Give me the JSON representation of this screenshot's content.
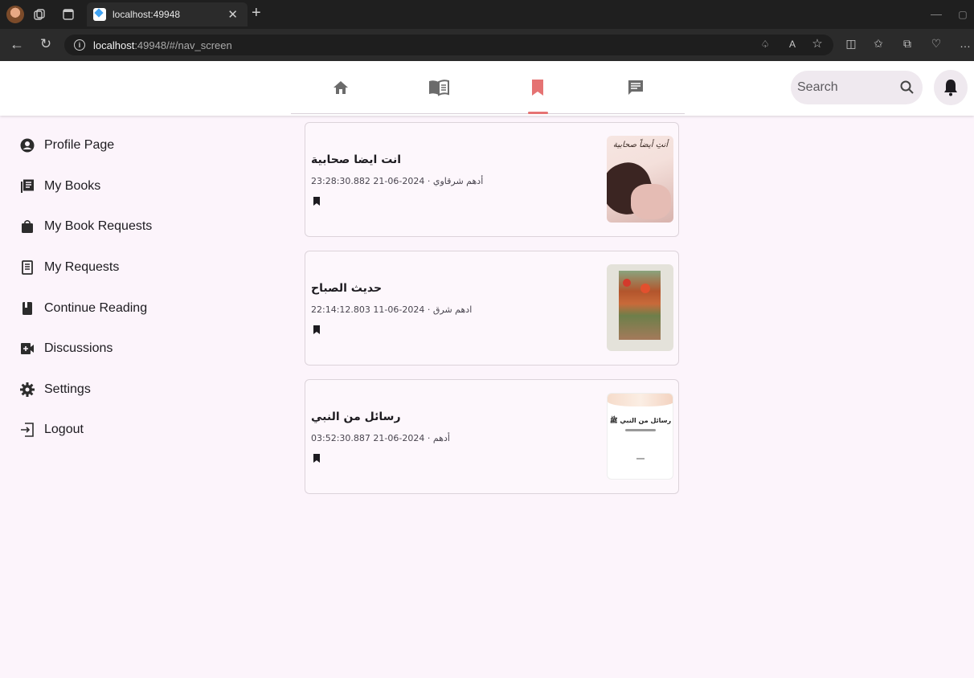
{
  "browser": {
    "tab_title": "localhost:49948",
    "url_host": "localhost",
    "url_rest": ":49948/#/nav_screen"
  },
  "header": {
    "nav_tabs": [
      {
        "icon": "home-icon"
      },
      {
        "icon": "menu-book-icon"
      },
      {
        "icon": "bookmark-icon",
        "selected": true
      },
      {
        "icon": "chat-icon"
      }
    ],
    "search_placeholder": "Search",
    "accent_color": "#e57373"
  },
  "sidebar": {
    "items": [
      {
        "label": "Profile Page",
        "icon": "account-circle-icon"
      },
      {
        "label": "My Books",
        "icon": "library-books-icon"
      },
      {
        "label": "My Book Requests",
        "icon": "shopping-bag-icon"
      },
      {
        "label": "My Requests",
        "icon": "receipt-icon"
      },
      {
        "label": "Continue Reading",
        "icon": "book-icon"
      },
      {
        "label": "Discussions",
        "icon": "video-chat-icon"
      },
      {
        "label": "Settings",
        "icon": "settings-icon"
      },
      {
        "label": "Logout",
        "icon": "logout-icon"
      }
    ]
  },
  "books": [
    {
      "title": "انت ايضا صحابية",
      "meta": "أدهم شرقاوي · 2024-06-21 23:28:30.882",
      "cover_title": "أنتِ أيضاً صحابية"
    },
    {
      "title": "حديث الصباح",
      "meta": "ادهم شرق · 2024-06-11 22:14:12.803",
      "cover_title": ""
    },
    {
      "title": "رسائل من النبي",
      "meta": "أدهم · 2024-06-21 03:52:30.887",
      "cover_title": "رسائل من النبي ﷺ"
    }
  ]
}
